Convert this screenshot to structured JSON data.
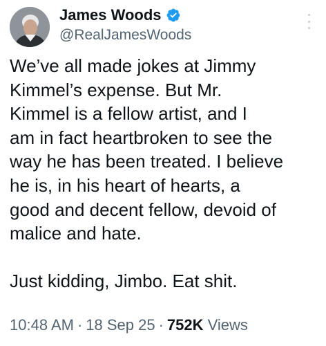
{
  "author": {
    "display_name": "James Woods",
    "handle": "@RealJamesWoods",
    "verified_icon": "verified-badge-icon",
    "avatar_icon": "profile-photo"
  },
  "more_icon": "more-options-icon",
  "tweet": {
    "text": "We’ve all made jokes at Jimmy\nKimmel’s expense. But Mr.\nKimmel is a fellow artist, and I\nam in fact heartbroken to see the\nway he has been treated. I believe\nhe is, in his heart of hearts, a\ngood and decent fellow, devoid of\nmalice and hate.\n\nJust kidding, Jimbo. Eat shit."
  },
  "meta": {
    "time": "10:48 AM",
    "separator": "·",
    "date": "18 Sep 25",
    "views_count": "752K",
    "views_label": "Views"
  },
  "colors": {
    "text_primary": "#0f1419",
    "text_secondary": "#536471",
    "verified_blue": "#1d9bf0"
  }
}
